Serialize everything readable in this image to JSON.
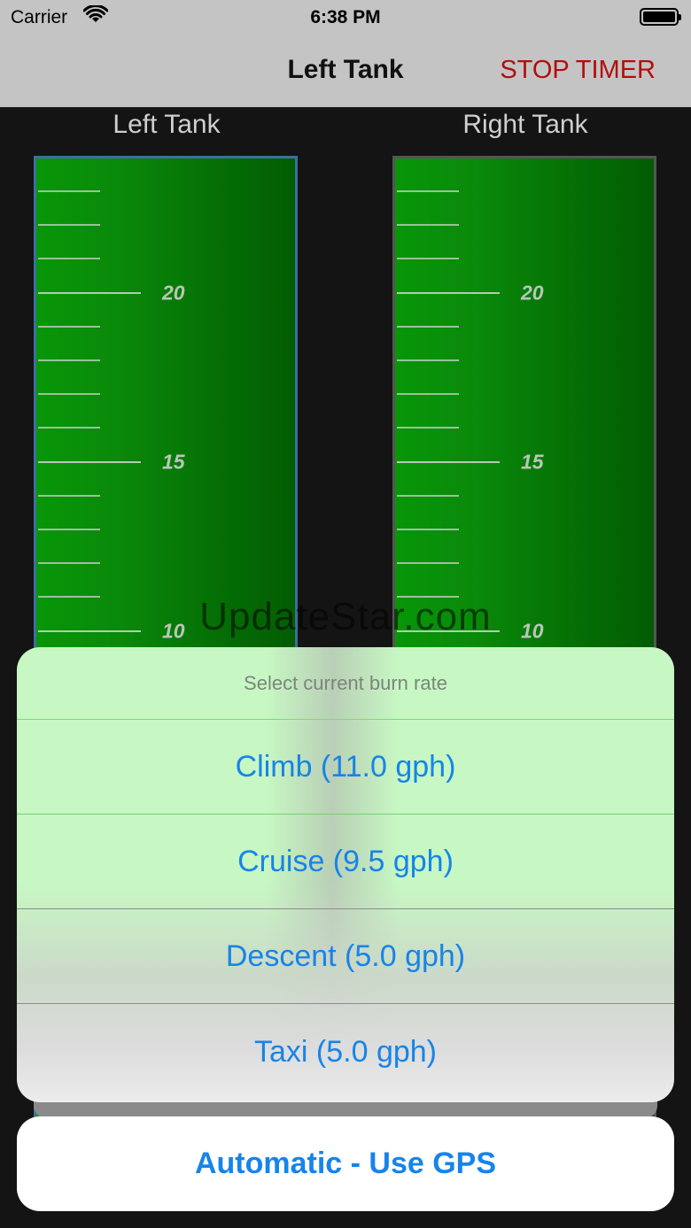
{
  "status_bar": {
    "carrier": "Carrier",
    "time": "6:38 PM"
  },
  "nav": {
    "title": "Left Tank",
    "action": "STOP TIMER"
  },
  "tanks": {
    "left": {
      "label": "Left Tank",
      "selected": true
    },
    "right": {
      "label": "Right Tank",
      "selected": false
    },
    "scale_labels": [
      "20",
      "15",
      "10"
    ]
  },
  "watermark": "UpdateStar.com",
  "action_sheet": {
    "title": "Select current burn rate",
    "options": [
      "Climb (11.0 gph)",
      "Cruise (9.5 gph)",
      "Descent (5.0 gph)",
      "Taxi (5.0 gph)"
    ],
    "primary": "Automatic - Use GPS"
  },
  "colors": {
    "accent": "#1784e8",
    "stop_timer": "#b20e0e",
    "tank_fill": "#0a8a0a",
    "selected_border": "#3d6f9c"
  }
}
